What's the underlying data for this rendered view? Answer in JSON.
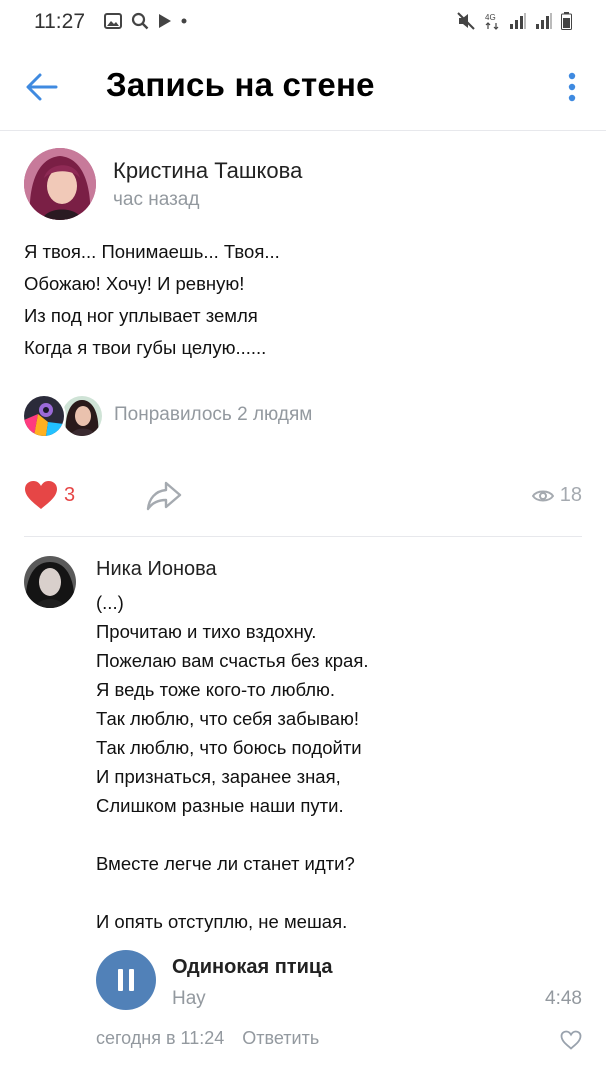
{
  "status_bar": {
    "time": "11:27",
    "left_icons": [
      "gallery-icon",
      "search-icon",
      "play-icon",
      "dot-icon"
    ],
    "right_icons": [
      "mute-icon",
      "4g-icon",
      "signal-icon",
      "signal-icon",
      "battery-icon"
    ],
    "network": "4G"
  },
  "header": {
    "title": "Запись на стене",
    "back_icon": "arrow-left-icon",
    "more_icon": "more-vertical-icon",
    "accent_color": "#3f8ae0"
  },
  "post": {
    "author": "Кристина Ташкова",
    "time": "час назад",
    "lines": [
      "Я твоя... Понимаешь... Твоя...",
      "Обожаю! Хочу! И ревную!",
      "Из под ног уплывает земля",
      "Когда я твои губы целую......"
    ],
    "liked_by_label": "Понравилось 2 людям",
    "likes_count": "3",
    "views_count": "18",
    "like_color": "#e64646"
  },
  "comment": {
    "author": "Ника Ионова",
    "lines": [
      "(...)",
      "Прочитаю и тихо вздохну.",
      "Пожелаю вам счастья без края.",
      "Я ведь тоже кого-то люблю.",
      "Так люблю, что себя забываю!",
      "Так люблю, что боюсь подойти",
      "И признаться, заранее зная,",
      "Слишком разные наши пути.",
      "",
      "Вместе легче ли станет идти?",
      "",
      "И опять отступлю, не мешая."
    ],
    "track": {
      "title": "Одинокая птица",
      "artist": "Нау",
      "duration": "4:48",
      "button_color": "#5181b8"
    },
    "time": "сегодня в 11:24",
    "reply_label": "Ответить"
  }
}
